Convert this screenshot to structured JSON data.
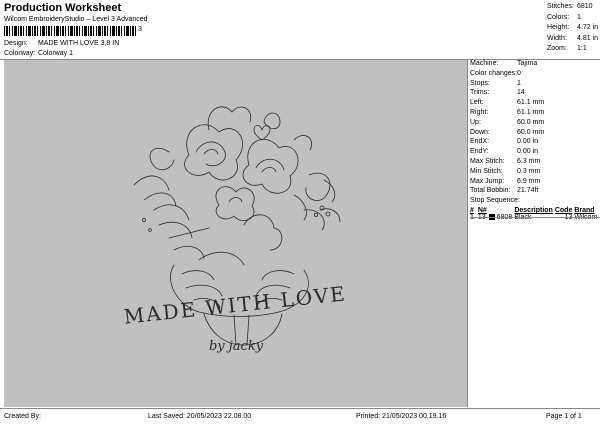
{
  "header": {
    "title": "Production Worksheet",
    "subtitle": "Wilcom EmbroideryStudio – Level 3 Advanced",
    "barcode_text": "3"
  },
  "meta": {
    "design_label": "Design:",
    "design_value": "MADE WITH LOVE 3,8 IN",
    "colorway_label": "Colorway:",
    "colorway_value": "Colorway 1"
  },
  "stats": [
    {
      "label": "Stitches:",
      "value": "6810"
    },
    {
      "label": "Colors:",
      "value": "1"
    },
    {
      "label": "Height:",
      "value": "4.72 in"
    },
    {
      "label": "Width:",
      "value": "4.81 in"
    },
    {
      "label": "Zoom:",
      "value": "1:1"
    }
  ],
  "design": {
    "text_main": "MADE WITH LOVE",
    "text_sub": "by jacky",
    "thread_color": "#2a2a2a",
    "background_color": "#c0c0c0"
  },
  "machine_info": [
    {
      "label": "Machine:",
      "value": "Tajima"
    },
    {
      "label": "Color changes:",
      "value": "0"
    },
    {
      "label": "Stops:",
      "value": "1"
    },
    {
      "label": "Trims:",
      "value": "14"
    },
    {
      "label": "Left:",
      "value": "61.1 mm"
    },
    {
      "label": "Right:",
      "value": "61.1 mm"
    },
    {
      "label": "Up:",
      "value": "60.0 mm"
    },
    {
      "label": "Down:",
      "value": "60.0 mm"
    },
    {
      "label": "EndX:",
      "value": "0.00 in"
    },
    {
      "label": "EndY:",
      "value": "0.00 in"
    },
    {
      "label": "Max Stitch:",
      "value": "6.3 mm"
    },
    {
      "label": "Min Stitch:",
      "value": "0.3 mm"
    },
    {
      "label": "Max Jump:",
      "value": "6.9 mm"
    },
    {
      "label": "Total Bobbin:",
      "value": "21.74ft"
    }
  ],
  "stop_sequence": {
    "title": "Stop Sequence:",
    "columns": {
      "num": "#",
      "n": "N#",
      "description": "Description",
      "code": "Code",
      "brand": "Brand"
    },
    "rows": [
      {
        "num": "1.",
        "n": "13",
        "swatch": "#000000",
        "color_code": "6808",
        "description": "Black",
        "code": "13",
        "brand": "Wilcom"
      }
    ]
  },
  "footer": {
    "created_by": "Created By:",
    "last_saved": "Last Saved: 20/05/2023 22.08.00",
    "printed": "Printed: 21/05/2023 00.19.16",
    "page": "Page 1 of 1"
  }
}
